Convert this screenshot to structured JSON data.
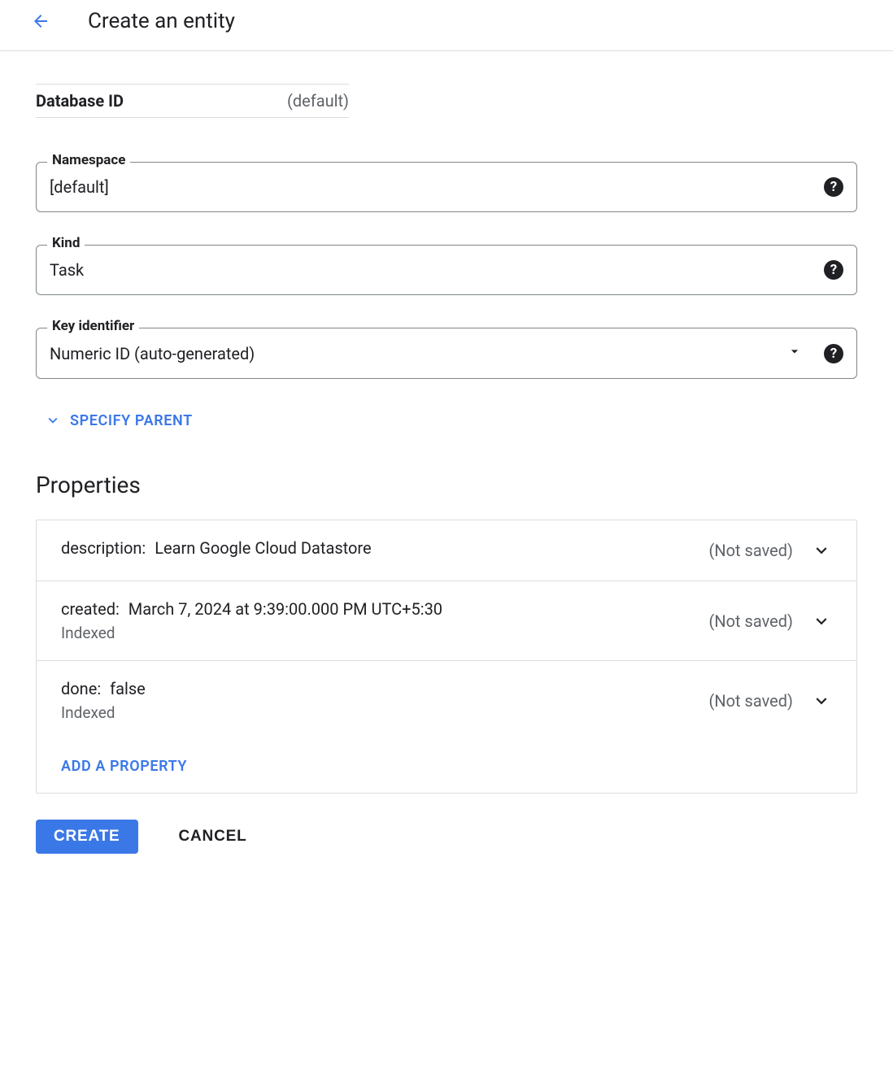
{
  "header": {
    "title": "Create an entity"
  },
  "database_id": {
    "label": "Database ID",
    "value": "(default)"
  },
  "fields": {
    "namespace": {
      "label": "Namespace",
      "value": "[default]"
    },
    "kind": {
      "label": "Kind",
      "value": "Task"
    },
    "key_identifier": {
      "label": "Key identifier",
      "value": "Numeric ID (auto-generated)"
    }
  },
  "specify_parent_label": "SPECIFY PARENT",
  "properties_title": "Properties",
  "not_saved_label": "(Not saved)",
  "indexed_label": "Indexed",
  "properties": [
    {
      "name": "description",
      "value": "Learn Google Cloud Datastore",
      "indexed": false
    },
    {
      "name": "created",
      "value": "March 7, 2024 at 9:39:00.000 PM UTC+5:30",
      "indexed": true
    },
    {
      "name": "done",
      "value": "false",
      "indexed": true
    }
  ],
  "add_property_label": "ADD A PROPERTY",
  "buttons": {
    "create": "CREATE",
    "cancel": "CANCEL"
  }
}
